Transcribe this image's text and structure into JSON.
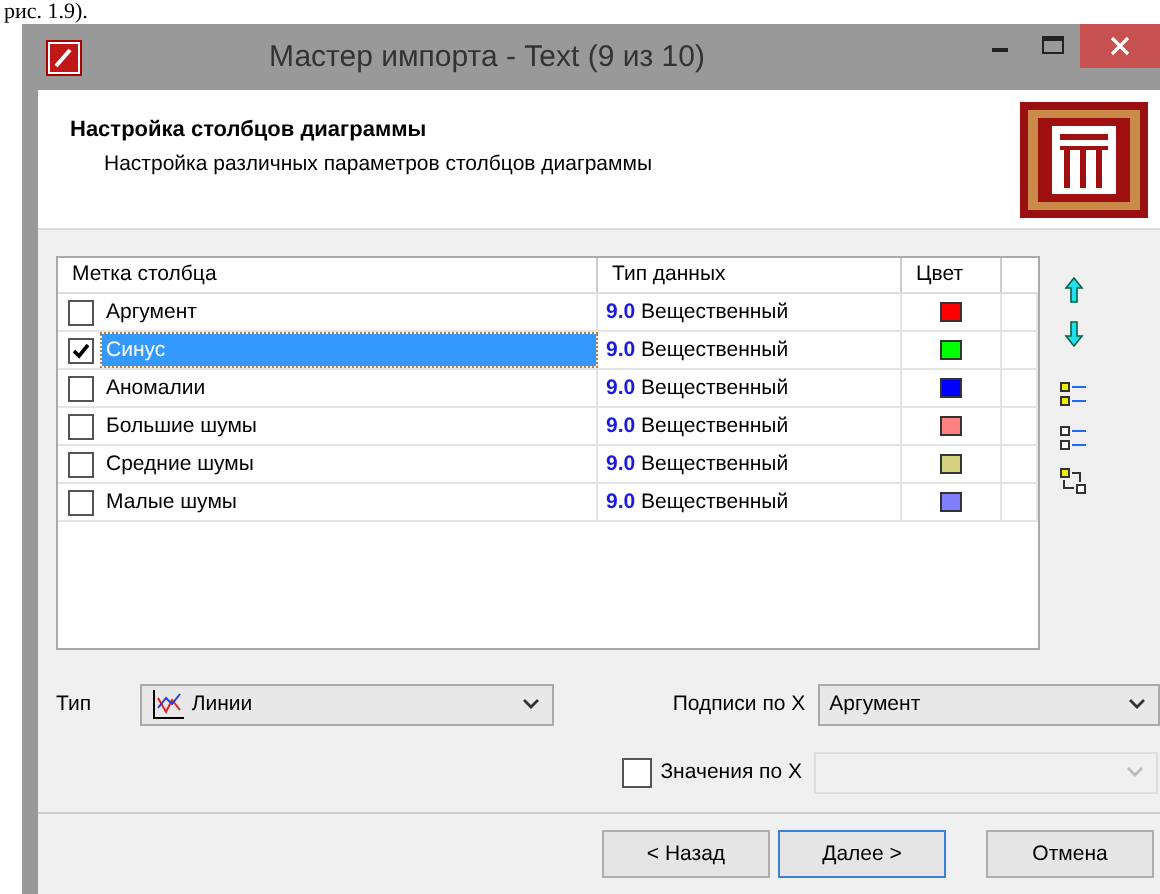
{
  "document_text": "рис. 1.9).",
  "window": {
    "title": "Мастер импорта - Text (9 из 10)"
  },
  "header": {
    "title": "Настройка столбцов диаграммы",
    "subtitle": "Настройка различных параметров столбцов диаграммы"
  },
  "table": {
    "columns": [
      "Метка столбца",
      "Тип данных",
      "Цвет"
    ],
    "rows": [
      {
        "label": "Аргумент",
        "checked": false,
        "selected": false,
        "type_code": "9.0",
        "type": "Вещественный",
        "color": "#ff0000"
      },
      {
        "label": "Синус",
        "checked": true,
        "selected": true,
        "type_code": "9.0",
        "type": "Вещественный",
        "color": "#00ff00"
      },
      {
        "label": "Аномалии",
        "checked": false,
        "selected": false,
        "type_code": "9.0",
        "type": "Вещественный",
        "color": "#0000ff"
      },
      {
        "label": "Большие шумы",
        "checked": false,
        "selected": false,
        "type_code": "9.0",
        "type": "Вещественный",
        "color": "#ff8080"
      },
      {
        "label": "Средние шумы",
        "checked": false,
        "selected": false,
        "type_code": "9.0",
        "type": "Вещественный",
        "color": "#d4d480"
      },
      {
        "label": "Малые шумы",
        "checked": false,
        "selected": false,
        "type_code": "9.0",
        "type": "Вещественный",
        "color": "#8080ff"
      }
    ]
  },
  "type_field": {
    "label": "Тип",
    "value": "Линии"
  },
  "x_labels_field": {
    "label": "Подписи по X",
    "value": "Аргумент"
  },
  "x_values_field": {
    "label": "Значения по X",
    "checked": false,
    "disabled": true
  },
  "buttons": [
    {
      "label": "< Назад",
      "default": false
    },
    {
      "label": "Далее >",
      "default": true
    },
    {
      "label": "Отмена",
      "default": false
    }
  ]
}
